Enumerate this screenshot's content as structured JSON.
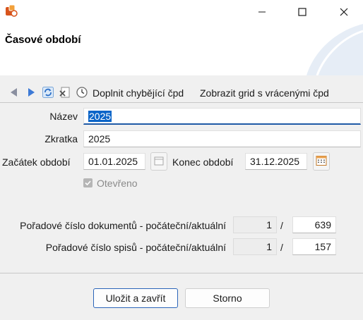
{
  "window": {
    "title_icon": "app-icon",
    "controls": [
      "minimize-icon",
      "maximize-icon",
      "close-icon"
    ]
  },
  "header": {
    "title": "Časové období"
  },
  "toolbar": {
    "icons": [
      "arrow-left-icon",
      "arrow-right-icon",
      "refresh-icon",
      "delete-icon",
      "clock-icon"
    ],
    "fill_missing": "Doplnit chybějící čpd",
    "show_grid": "Zobrazit grid s vrácenými čpd"
  },
  "form": {
    "name_label": "Název",
    "name_value": "2025",
    "abbr_label": "Zkratka",
    "abbr_value": "2025",
    "start_label": "Začátek období",
    "start_value": "01.01.2025",
    "end_label": "Konec období",
    "end_value": "31.12.2025",
    "open_label": "Otevřeno",
    "open_checked": true,
    "doc_seq_label": "Pořadové číslo dokumentů - počáteční/aktuální",
    "doc_seq_start": "1",
    "doc_seq_current": "639",
    "file_seq_label": "Pořadové číslo spisů - počáteční/aktuální",
    "file_seq_start": "1",
    "file_seq_current": "157",
    "slash": "/"
  },
  "buttons": {
    "save_close": "Uložit a zavřít",
    "cancel": "Storno"
  },
  "colors": {
    "accent": "#1f5aa6",
    "selection": "#0a64c8",
    "background": "#f0f0f0"
  }
}
